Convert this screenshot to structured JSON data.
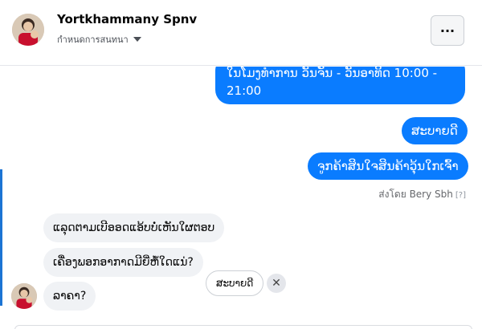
{
  "header": {
    "name": "Yortkhammany Spnv",
    "subtitle": "กำหนดการสนทนา",
    "more_label": "···"
  },
  "messages_out": [
    "ໃນໂມງທຳການ ວັນຈັນ - ວັນອາທິດ  10:00 - 21:00",
    "ສະບາຍດີ",
    "ຈູກຄ້າສິນໃຈສິນຄ້າວຸ້ນໃກເຈົ້າ"
  ],
  "sent_by": {
    "label": "ส่งโดย Bery Sbh",
    "help": "[?]"
  },
  "messages_in": [
    "ແລຸດຕາມເບີ​ອອດແອ້ບບໍ່ເຫັນໃຜຕອບ",
    "ເຄື່ອງພອກອາກາດມີຍີ່ຫໍ້ໃດແນ່?",
    "ລາຄາ?"
  ],
  "quick_reply": {
    "label": "ສະບາຍດີ",
    "close": "✕"
  },
  "colors": {
    "outgoing_bubble": "#0a7cff",
    "incoming_bubble": "#f0f2f5"
  }
}
